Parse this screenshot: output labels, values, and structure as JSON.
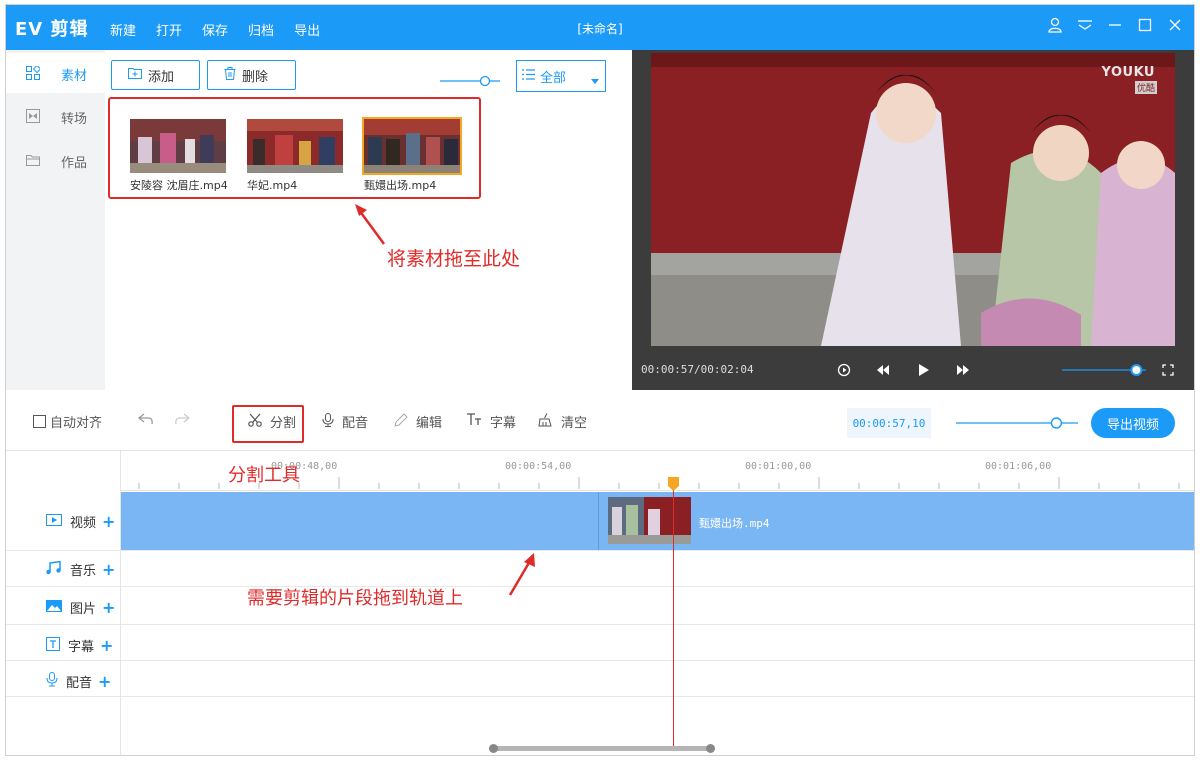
{
  "app": {
    "logo": "EV 剪辑",
    "menu": [
      "新建",
      "打开",
      "保存",
      "归档",
      "导出"
    ],
    "doc_title": "[未命名]"
  },
  "sidebar": {
    "items": [
      {
        "label": "素材",
        "icon": "grid-icon",
        "active": true
      },
      {
        "label": "转场",
        "icon": "transition-icon",
        "active": false
      },
      {
        "label": "作品",
        "icon": "folder-icon",
        "active": false
      }
    ]
  },
  "media": {
    "add_label": "添加",
    "delete_label": "删除",
    "filter_label": "全部",
    "thumb_size_level": 0.8,
    "files": [
      {
        "name": "安陵容 沈眉庄.mp4",
        "selected": false
      },
      {
        "name": "华妃.mp4",
        "selected": false
      },
      {
        "name": "甄嬛出场.mp4",
        "selected": true
      }
    ],
    "annotation": "将素材拖至此处"
  },
  "preview": {
    "watermark": "YOUKU",
    "watermark_badge": "优酷",
    "timecode": "00:00:57/00:02:04",
    "volume_level": 0.95
  },
  "toolbar": {
    "auto_align_label": "自动对齐",
    "split_label": "分割",
    "dub_label": "配音",
    "edit_label": "编辑",
    "subtitle_label": "字幕",
    "clear_label": "清空",
    "current_time": "00:00:57,10",
    "zoom_level": 0.8,
    "export_label": "导出视频",
    "split_annotation": "分割工具"
  },
  "timeline": {
    "ruler_labels": [
      "00:00:48,00",
      "00:00:54,00",
      "00:01:00,00",
      "00:01:06,00"
    ],
    "tracks": [
      {
        "label": "视频",
        "icon": "video-icon"
      },
      {
        "label": "音乐",
        "icon": "music-icon"
      },
      {
        "label": "图片",
        "icon": "image-icon"
      },
      {
        "label": "字幕",
        "icon": "text-icon"
      },
      {
        "label": "配音",
        "icon": "mic-icon"
      }
    ],
    "clip_name": "甄嬛出场.mp4",
    "annotation": "需要剪辑的片段拖到轨道上"
  },
  "colors": {
    "accent": "#1b9af7",
    "annotation": "#e02b2b",
    "track_fill": "#7ab6f4",
    "playhead": "#e02b2b",
    "playhead_handle": "#f5a623"
  }
}
